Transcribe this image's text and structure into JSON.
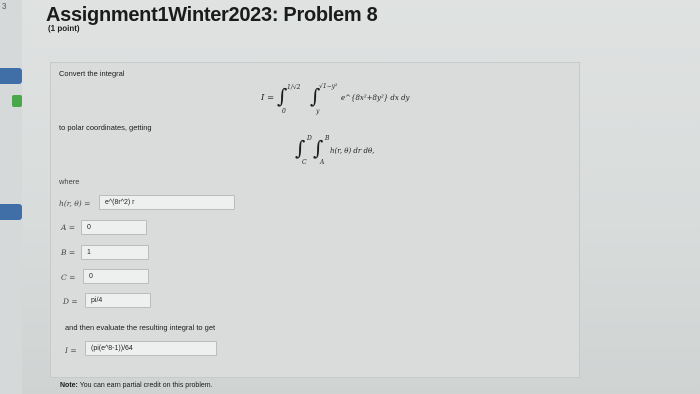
{
  "header": {
    "title": "Assignment1Winter2023: Problem 8",
    "points": "(1 point)"
  },
  "sidebar": {
    "number": "3"
  },
  "problem": {
    "intro": "Convert the integral",
    "integral": {
      "lhs": "I =",
      "outer_upper": "1/√2",
      "outer_lower": "0",
      "inner_upper": "√1−y²",
      "inner_lower": "y",
      "integrand": "e^{8x²+8y²} dx dy"
    },
    "middle": "to polar coordinates, getting",
    "polar_integral": {
      "outer_upper": "D",
      "outer_lower": "C",
      "inner_upper": "B",
      "inner_lower": "A",
      "integrand": "h(r, θ) dr dθ,"
    },
    "where": "where",
    "answers": [
      {
        "label": "h(r, θ) =",
        "value": "e^(8r^2) r"
      },
      {
        "label": "A =",
        "value": "0"
      },
      {
        "label": "B =",
        "value": "1"
      },
      {
        "label": "C =",
        "value": "0"
      },
      {
        "label": "D =",
        "value": "pi/4"
      }
    ],
    "evaluate": "and then evaluate the resulting integral to get",
    "result": {
      "label": "I =",
      "value": "(pi(e^8-1))/64"
    },
    "note_bold": "Note:",
    "note": "You can earn partial credit on this problem."
  }
}
